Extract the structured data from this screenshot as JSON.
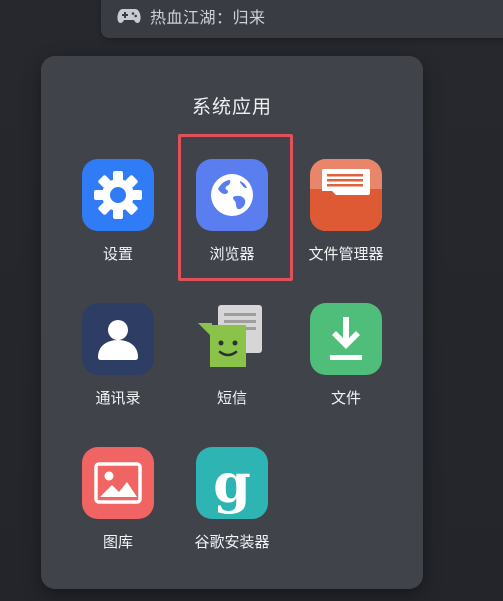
{
  "top_notification": {
    "title": "热血江湖：归来",
    "icon": "gamepad-icon"
  },
  "panel": {
    "title": "系统应用"
  },
  "apps": [
    {
      "label": "设置",
      "icon": "gear-icon",
      "color": "#2f7cf6"
    },
    {
      "label": "浏览器",
      "icon": "globe-icon",
      "color": "#5a7ef0"
    },
    {
      "label": "文件管理器",
      "icon": "file-manager-icon",
      "color": "#e2603c"
    },
    {
      "label": "通讯录",
      "icon": "contact-icon",
      "color": "#2e3d63"
    },
    {
      "label": "短信",
      "icon": "sms-icon",
      "color": "#8bc34a"
    },
    {
      "label": "文件",
      "icon": "download-icon",
      "color": "#4fbe7a"
    },
    {
      "label": "图库",
      "icon": "gallery-icon",
      "color": "#f06464"
    },
    {
      "label": "谷歌安装器",
      "icon": "google-installer-icon",
      "color": "#2fb4b4",
      "glyph": "g"
    }
  ],
  "highlight": {
    "color": "#e2505a",
    "target": "浏览器"
  }
}
